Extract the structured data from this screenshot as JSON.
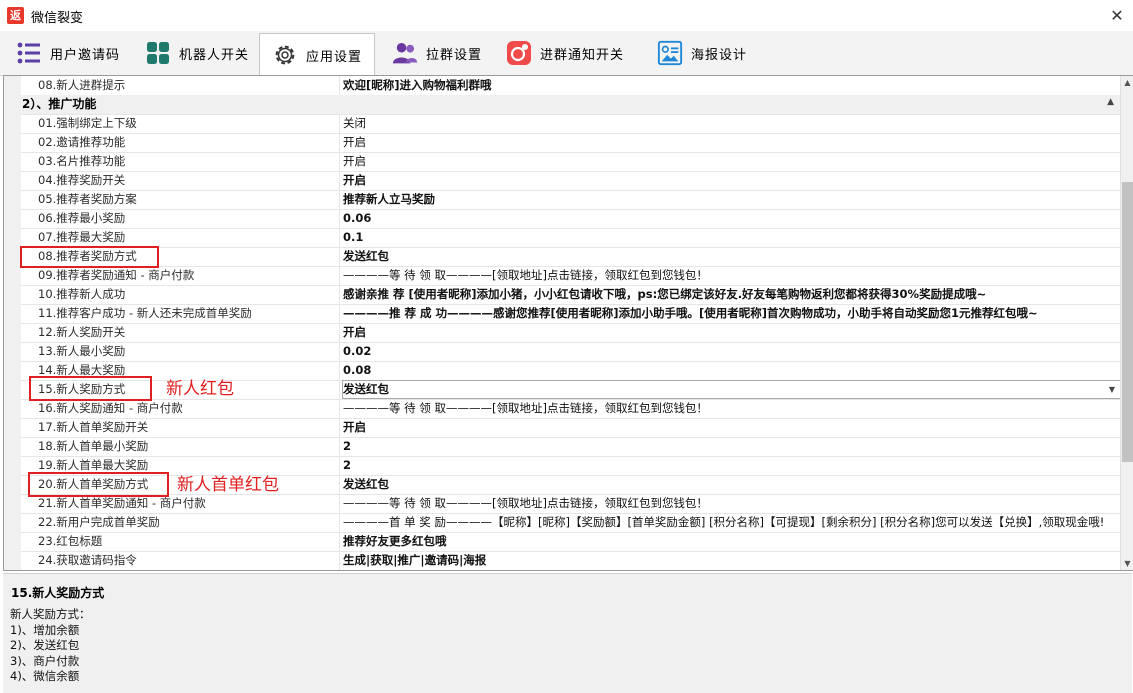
{
  "window": {
    "title": "微信裂变",
    "app_icon_label": "返",
    "close_label": "✕"
  },
  "toolbar": {
    "tabs": [
      {
        "label": "用户邀请码",
        "icon": "list-icon",
        "color": "#5b3fa8"
      },
      {
        "label": "机器人开关",
        "icon": "grid-icon",
        "color": "#1f7a6d"
      },
      {
        "label": "应用设置",
        "icon": "gear-icon",
        "color": "#333333",
        "active": true
      },
      {
        "label": "拉群设置",
        "icon": "users-icon",
        "color": "#6a3aa0"
      },
      {
        "label": "进群通知开关",
        "icon": "notification-icon",
        "color": "#f04a4a"
      },
      {
        "label": "海报设计",
        "icon": "poster-icon",
        "color": "#1e88d6"
      }
    ]
  },
  "grid": {
    "top_row": {
      "name": "08.新人进群提示",
      "value": "欢迎[昵称]进入购物福利群哦"
    },
    "category": {
      "label": "2）、推广功能",
      "collapse": "▲"
    },
    "rows": [
      {
        "name": "01.强制绑定上下级",
        "value": "关闭"
      },
      {
        "name": "02.邀请推荐功能",
        "value": "开启"
      },
      {
        "name": "03.名片推荐功能",
        "value": "开启"
      },
      {
        "name": "04.推荐奖励开关",
        "value": "开启"
      },
      {
        "name": "05.推荐者奖励方案",
        "value": "推荐新人立马奖励"
      },
      {
        "name": "06.推荐最小奖励",
        "value": "0.06"
      },
      {
        "name": "07.推荐最大奖励",
        "value": "0.1"
      },
      {
        "name": "08.推荐者奖励方式",
        "value": "发送红包"
      },
      {
        "name": "09.推荐者奖励通知 - 商户付款",
        "value": "————等 待 领 取————[领取地址]点击链接，领取红包到您钱包！"
      },
      {
        "name": "10.推荐新人成功",
        "value": "感谢亲推 荐 [使用者昵称]添加小猪，小小红包请收下哦，ps:您已绑定该好友.好友每笔购物返利您都将获得30%奖励提成哦~"
      },
      {
        "name": "11.推荐客户成功 - 新人还未完成首单奖励",
        "value": "————推 荐 成 功————感谢您推荐[使用者昵称]添加小助手哦。[使用者昵称]首次购物成功，小助手将自动奖励您1元推荐红包哦~"
      },
      {
        "name": "12.新人奖励开关",
        "value": "开启"
      },
      {
        "name": "13.新人最小奖励",
        "value": "0.02"
      },
      {
        "name": "14.新人最大奖励",
        "value": "0.08"
      },
      {
        "name": "15.新人奖励方式",
        "value": "发送红包"
      },
      {
        "name": "16.新人奖励通知 - 商户付款",
        "value": "————等 待 领 取————[领取地址]点击链接，领取红包到您钱包！"
      },
      {
        "name": "17.新人首单奖励开关",
        "value": "开启"
      },
      {
        "name": "18.新人首单最小奖励",
        "value": "2"
      },
      {
        "name": "19.新人首单最大奖励",
        "value": "2"
      },
      {
        "name": "20.新人首单奖励方式",
        "value": "发送红包"
      },
      {
        "name": "21.新人首单奖励通知 - 商户付款",
        "value": "————等 待 领 取————[领取地址]点击链接，领取红包到您钱包！"
      },
      {
        "name": "22.新用户完成首单奖励",
        "value": "————首 单 奖 励————【昵称】[昵称]【奖励额】[首单奖励金额] [积分名称]【可提现】[剩余积分] [积分名称]您可以发送【兑换】,领取现金哦!"
      },
      {
        "name": "23.红包标题",
        "value": "推荐好友更多红包哦"
      },
      {
        "name": "24.获取邀请码指令",
        "value": "生成|获取|推广|邀请码|海报"
      }
    ],
    "dropdown_arrow": "▼",
    "scroll_up": "▲",
    "scroll_down": "▼"
  },
  "annotations": {
    "new_user_redpacket": "新人红包",
    "new_user_first_order_redpacket": "新人首单红包",
    "color": "#e02020"
  },
  "description": {
    "title": "15.新人奖励方式",
    "lines": [
      "新人奖励方式：",
      "1)、增加余额",
      "2)、发送红包",
      "3)、商户付款",
      "4)、微信余额"
    ]
  }
}
